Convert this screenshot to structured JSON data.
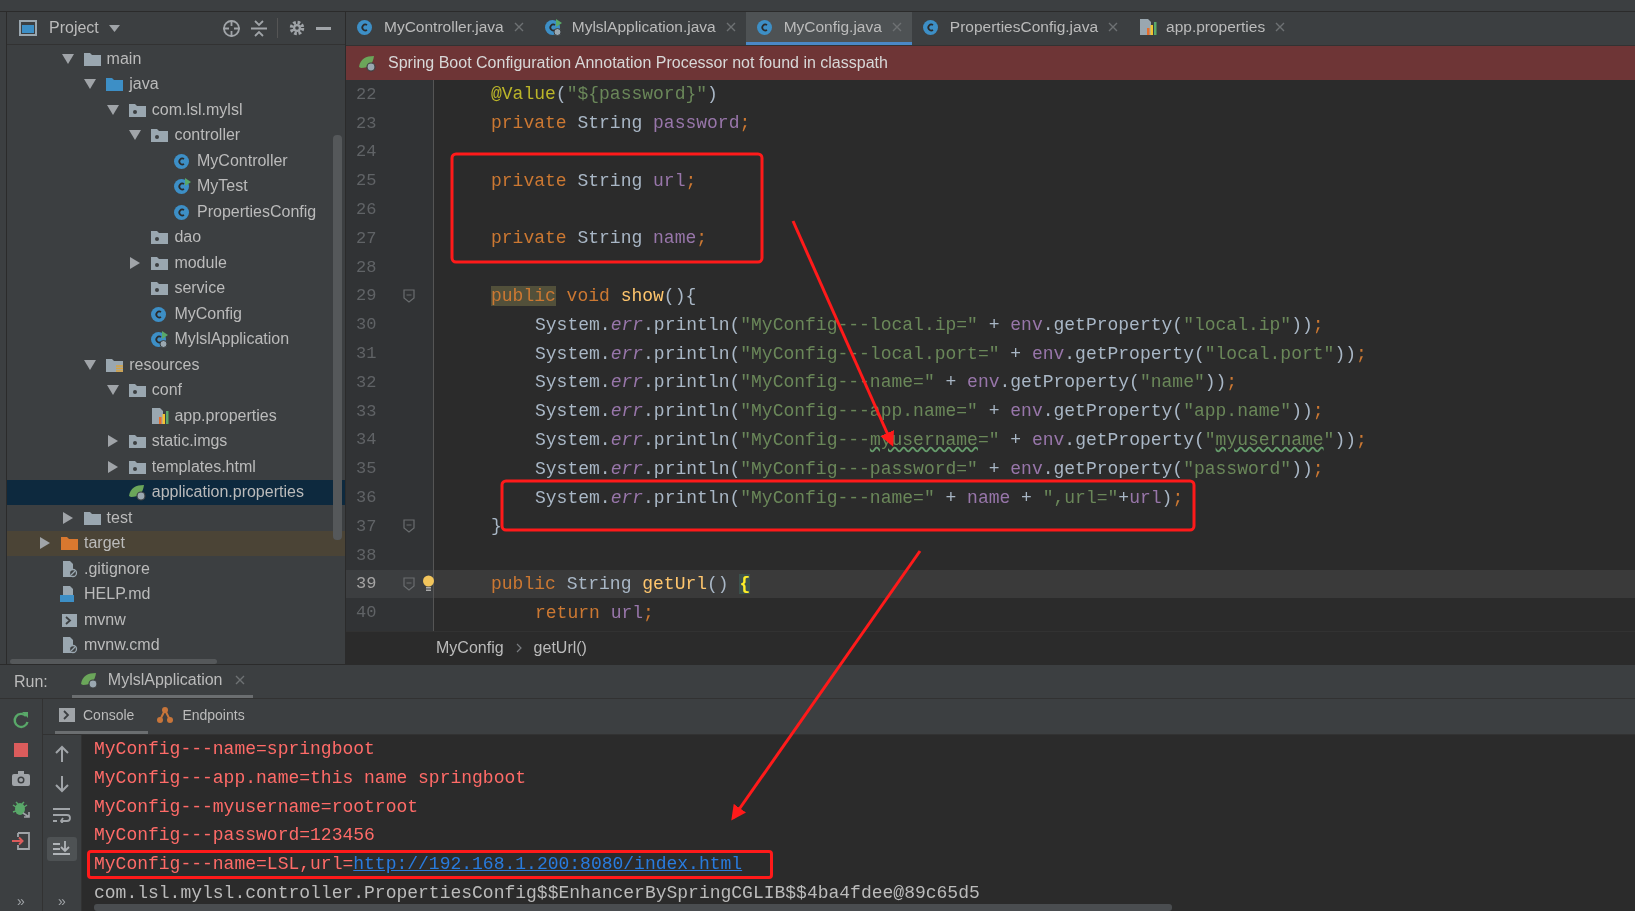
{
  "project": {
    "title": "Project",
    "tree": [
      {
        "children": [
          {
            "label": "main",
            "kind": "folder",
            "expanded": true,
            "selected": false,
            "children": [
              {
                "label": "java",
                "kind": "source-folder",
                "expanded": true,
                "selected": false,
                "children": [
                  {
                    "label": "com.lsl.mylsl",
                    "kind": "package",
                    "expanded": true,
                    "selected": false,
                    "children": [
                      {
                        "label": "controller",
                        "kind": "package",
                        "expanded": true,
                        "selected": false,
                        "children": [
                          {
                            "label": "MyController",
                            "kind": "class",
                            "selected": false
                          },
                          {
                            "label": "MyTest",
                            "kind": "test-class",
                            "selected": false
                          },
                          {
                            "label": "PropertiesConfig",
                            "kind": "class",
                            "selected": false
                          }
                        ]
                      },
                      {
                        "label": "dao",
                        "kind": "package",
                        "selected": false
                      },
                      {
                        "label": "module",
                        "kind": "package",
                        "expanded": false,
                        "selected": false
                      },
                      {
                        "label": "service",
                        "kind": "package",
                        "selected": false
                      },
                      {
                        "label": "MyConfig",
                        "kind": "class",
                        "selected": false
                      },
                      {
                        "label": "MylslApplication",
                        "kind": "spring-class",
                        "selected": false
                      }
                    ]
                  }
                ]
              },
              {
                "label": "resources",
                "kind": "resources-folder",
                "expanded": true,
                "selected": false,
                "children": [
                  {
                    "label": "conf",
                    "kind": "package",
                    "expanded": true,
                    "selected": false,
                    "children": [
                      {
                        "label": "app.properties",
                        "kind": "properties",
                        "selected": false
                      }
                    ]
                  },
                  {
                    "label": "static.imgs",
                    "kind": "package",
                    "expanded": false,
                    "selected": false
                  },
                  {
                    "label": "templates.html",
                    "kind": "package",
                    "expanded": false,
                    "selected": false
                  },
                  {
                    "label": "application.properties",
                    "kind": "spring-properties",
                    "selected": true
                  }
                ]
              }
            ]
          },
          {
            "label": "test",
            "kind": "folder",
            "expanded": false,
            "selected": false
          }
        ]
      },
      {
        "label": "target",
        "kind": "excluded-folder",
        "expanded": false,
        "selected": false
      },
      {
        "label": ".gitignore",
        "kind": "ignore-file",
        "selected": false
      },
      {
        "label": "HELP.md",
        "kind": "markdown",
        "selected": false
      },
      {
        "label": "mvnw",
        "kind": "script",
        "selected": false
      },
      {
        "label": "mvnw.cmd",
        "kind": "ignore-file",
        "selected": false
      }
    ]
  },
  "editor": {
    "tabs": [
      {
        "label": "MyController.java",
        "kind": "class",
        "selected": false
      },
      {
        "label": "MylslApplication.java",
        "kind": "spring-class",
        "selected": false
      },
      {
        "label": "MyConfig.java",
        "kind": "class",
        "selected": true
      },
      {
        "label": "PropertiesConfig.java",
        "kind": "class",
        "selected": false
      },
      {
        "label": "app.properties",
        "kind": "properties",
        "selected": false
      }
    ],
    "banner": "Spring Boot Configuration Annotation Processor not found in classpath",
    "lines": [
      {
        "number": "22",
        "kind": "member",
        "current": false,
        "fold": false,
        "bulb": false,
        "tokens": [
          {
            "kind": "annotation",
            "text": "@Value"
          },
          {
            "kind": "plain",
            "text": "("
          },
          {
            "kind": "string",
            "text": "\"${password}\""
          },
          {
            "kind": "plain",
            "text": ")"
          }
        ]
      },
      {
        "number": "23",
        "kind": "member",
        "current": false,
        "fold": false,
        "bulb": false,
        "tokens": [
          {
            "kind": "keyword",
            "text": "private "
          },
          {
            "kind": "plain",
            "text": "String "
          },
          {
            "kind": "field",
            "text": "password"
          },
          {
            "kind": "keyword",
            "text": ";"
          }
        ]
      },
      {
        "number": "24",
        "current": false,
        "fold": false,
        "bulb": false
      },
      {
        "number": "25",
        "kind": "member",
        "current": false,
        "fold": false,
        "bulb": false,
        "tokens": [
          {
            "kind": "keyword",
            "text": "private "
          },
          {
            "kind": "plain",
            "text": "String "
          },
          {
            "kind": "field",
            "text": "url"
          },
          {
            "kind": "keyword",
            "text": ";"
          }
        ]
      },
      {
        "number": "26",
        "current": false,
        "fold": false,
        "bulb": false
      },
      {
        "number": "27",
        "kind": "member",
        "current": false,
        "fold": false,
        "bulb": false,
        "tokens": [
          {
            "kind": "keyword",
            "text": "private "
          },
          {
            "kind": "plain",
            "text": "String "
          },
          {
            "kind": "field",
            "text": "name"
          },
          {
            "kind": "keyword",
            "text": ";"
          }
        ]
      },
      {
        "number": "28",
        "current": false,
        "fold": false,
        "bulb": false
      },
      {
        "number": "29",
        "kind": "member",
        "current": false,
        "fold": true,
        "bulb": false,
        "tokens": [
          {
            "kind": "keyword-marked",
            "text": "public"
          },
          {
            "kind": "keyword",
            "text": " void "
          },
          {
            "kind": "method",
            "text": "show"
          },
          {
            "kind": "plain",
            "text": "(){"
          }
        ]
      },
      {
        "number": "30",
        "kind": "body",
        "current": false,
        "fold": false,
        "bulb": false,
        "tokens": [
          {
            "kind": "plain",
            "text": "System."
          },
          {
            "kind": "static",
            "text": "err"
          },
          {
            "kind": "plain",
            "text": ".println("
          },
          {
            "kind": "string",
            "text": "\"MyConfig---local.ip=\""
          },
          {
            "kind": "plain",
            "text": " + "
          },
          {
            "kind": "field",
            "text": "env"
          },
          {
            "kind": "plain",
            "text": ".getProperty("
          },
          {
            "kind": "string",
            "text": "\"local.ip\""
          },
          {
            "kind": "plain",
            "text": "))"
          },
          {
            "kind": "keyword",
            "text": ";"
          }
        ]
      },
      {
        "number": "31",
        "kind": "body",
        "current": false,
        "fold": false,
        "bulb": false,
        "tokens": [
          {
            "kind": "plain",
            "text": "System."
          },
          {
            "kind": "static",
            "text": "err"
          },
          {
            "kind": "plain",
            "text": ".println("
          },
          {
            "kind": "string",
            "text": "\"MyConfig---local.port=\""
          },
          {
            "kind": "plain",
            "text": " + "
          },
          {
            "kind": "field",
            "text": "env"
          },
          {
            "kind": "plain",
            "text": ".getProperty("
          },
          {
            "kind": "string",
            "text": "\"local.port\""
          },
          {
            "kind": "plain",
            "text": "))"
          },
          {
            "kind": "keyword",
            "text": ";"
          }
        ]
      },
      {
        "number": "32",
        "kind": "body",
        "current": false,
        "fold": false,
        "bulb": false,
        "tokens": [
          {
            "kind": "plain",
            "text": "System."
          },
          {
            "kind": "static",
            "text": "err"
          },
          {
            "kind": "plain",
            "text": ".println("
          },
          {
            "kind": "string",
            "text": "\"MyConfig---name=\""
          },
          {
            "kind": "plain",
            "text": " + "
          },
          {
            "kind": "field",
            "text": "env"
          },
          {
            "kind": "plain",
            "text": ".getProperty("
          },
          {
            "kind": "string",
            "text": "\"name\""
          },
          {
            "kind": "plain",
            "text": "))"
          },
          {
            "kind": "keyword",
            "text": ";"
          }
        ]
      },
      {
        "number": "33",
        "kind": "body",
        "current": false,
        "fold": false,
        "bulb": false,
        "tokens": [
          {
            "kind": "plain",
            "text": "System."
          },
          {
            "kind": "static",
            "text": "err"
          },
          {
            "kind": "plain",
            "text": ".println("
          },
          {
            "kind": "string",
            "text": "\"MyConfig---app.name=\""
          },
          {
            "kind": "plain",
            "text": " + "
          },
          {
            "kind": "field",
            "text": "env"
          },
          {
            "kind": "plain",
            "text": ".getProperty("
          },
          {
            "kind": "string",
            "text": "\"app.name\""
          },
          {
            "kind": "plain",
            "text": "))"
          },
          {
            "kind": "keyword",
            "text": ";"
          }
        ]
      },
      {
        "number": "34",
        "kind": "body",
        "current": false,
        "fold": false,
        "bulb": false,
        "tokens": [
          {
            "kind": "plain",
            "text": "System."
          },
          {
            "kind": "static",
            "text": "err"
          },
          {
            "kind": "plain",
            "text": ".println("
          },
          {
            "kind": "string",
            "text": "\"MyConfig---"
          },
          {
            "kind": "string-typo",
            "text": "myusername"
          },
          {
            "kind": "string",
            "text": "=\""
          },
          {
            "kind": "plain",
            "text": " + "
          },
          {
            "kind": "field",
            "text": "env"
          },
          {
            "kind": "plain",
            "text": ".getProperty("
          },
          {
            "kind": "string",
            "text": "\""
          },
          {
            "kind": "string-typo",
            "text": "myusername"
          },
          {
            "kind": "string",
            "text": "\""
          },
          {
            "kind": "plain",
            "text": "))"
          },
          {
            "kind": "keyword",
            "text": ";"
          }
        ]
      },
      {
        "number": "35",
        "kind": "body",
        "current": false,
        "fold": false,
        "bulb": false,
        "tokens": [
          {
            "kind": "plain",
            "text": "System."
          },
          {
            "kind": "static",
            "text": "err"
          },
          {
            "kind": "plain",
            "text": ".println("
          },
          {
            "kind": "string",
            "text": "\"MyConfig---password=\""
          },
          {
            "kind": "plain",
            "text": " + "
          },
          {
            "kind": "field",
            "text": "env"
          },
          {
            "kind": "plain",
            "text": ".getProperty("
          },
          {
            "kind": "string",
            "text": "\"password\""
          },
          {
            "kind": "plain",
            "text": "))"
          },
          {
            "kind": "keyword",
            "text": ";"
          }
        ]
      },
      {
        "number": "36",
        "kind": "body",
        "current": false,
        "fold": false,
        "bulb": false,
        "tokens": [
          {
            "kind": "plain",
            "text": "System."
          },
          {
            "kind": "static",
            "text": "err"
          },
          {
            "kind": "plain",
            "text": ".println("
          },
          {
            "kind": "string",
            "text": "\"MyConfig---name=\""
          },
          {
            "kind": "plain",
            "text": " + "
          },
          {
            "kind": "field",
            "text": "name"
          },
          {
            "kind": "plain",
            "text": " + "
          },
          {
            "kind": "string",
            "text": "\",url=\""
          },
          {
            "kind": "plain",
            "text": "+"
          },
          {
            "kind": "field",
            "text": "url"
          },
          {
            "kind": "plain",
            "text": ")"
          },
          {
            "kind": "keyword",
            "text": ";"
          }
        ]
      },
      {
        "number": "37",
        "kind": "member",
        "current": false,
        "fold": true,
        "bulb": false,
        "tokens": [
          {
            "kind": "plain",
            "text": "}"
          }
        ]
      },
      {
        "number": "38",
        "current": false,
        "fold": false,
        "bulb": false
      },
      {
        "number": "39",
        "kind": "member",
        "current": true,
        "fold": true,
        "bulb": true,
        "tokens": [
          {
            "kind": "keyword",
            "text": "public "
          },
          {
            "kind": "plain",
            "text": "String "
          },
          {
            "kind": "method",
            "text": "getUrl"
          },
          {
            "kind": "plain",
            "text": "() "
          },
          {
            "kind": "brace-matched",
            "text": "{"
          }
        ]
      },
      {
        "number": "40",
        "kind": "body",
        "current": false,
        "fold": false,
        "bulb": false,
        "tokens": [
          {
            "kind": "keyword",
            "text": "return "
          },
          {
            "kind": "field",
            "text": "url"
          },
          {
            "kind": "keyword",
            "text": ";"
          }
        ]
      }
    ],
    "breadcrumb": [
      "MyConfig",
      "getUrl()"
    ]
  },
  "run": {
    "label": "Run:",
    "tab": "MylslApplication",
    "more_left": "»",
    "more_right": "»",
    "console_tabs": [
      {
        "label": "Console",
        "kind": "console",
        "selected": true
      },
      {
        "label": "Endpoints",
        "kind": "endpoints",
        "selected": false
      }
    ],
    "console": [
      {
        "highlighted": false,
        "segments": [
          {
            "kind": "err",
            "text": "MyConfig---name=springboot"
          }
        ]
      },
      {
        "highlighted": false,
        "segments": [
          {
            "kind": "err",
            "text": "MyConfig---app.name=this name springboot"
          }
        ]
      },
      {
        "highlighted": false,
        "segments": [
          {
            "kind": "err",
            "text": "MyConfig---myusername=rootroot"
          }
        ]
      },
      {
        "highlighted": false,
        "segments": [
          {
            "kind": "err",
            "text": "MyConfig---password=123456"
          }
        ]
      },
      {
        "highlighted": true,
        "segments": [
          {
            "kind": "err",
            "text": "MyConfig---name=LSL,url="
          },
          {
            "kind": "link",
            "text": "http://192.168.1.200:8080/index.html"
          }
        ]
      },
      {
        "highlighted": false,
        "segments": [
          {
            "kind": "out",
            "text": "com.lsl.mylsl.controller.PropertiesConfig$$EnhancerBySpringCGLIB$$4ba4fdee@89c65d5"
          }
        ]
      }
    ]
  }
}
